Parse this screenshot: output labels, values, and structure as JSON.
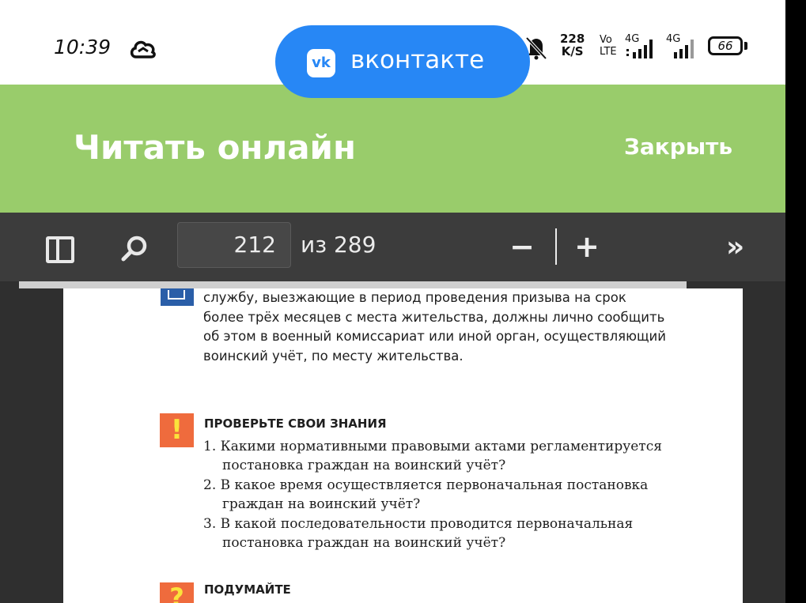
{
  "status_bar": {
    "time": "10:39",
    "net_speed_value": "228",
    "net_speed_unit": "K/S",
    "volte_line1": "Vo",
    "volte_line2": "LTE",
    "signal1_label": "4G",
    "signal2_label": "4G",
    "battery": "66"
  },
  "vk_pill": {
    "logo_letter": "vk",
    "label": "вконтакте"
  },
  "header": {
    "title": "Читать онлайн",
    "close": "Закрыть",
    "color": "#99cc6b"
  },
  "pdf_toolbar": {
    "page_current": "212",
    "page_total_label": "из 289",
    "zoom_out": "−",
    "zoom_in": "+",
    "more": "»",
    "progress_fraction": 0.85
  },
  "document": {
    "top_paragraph": "службу, выезжающие в период проведения призыва на срок более трёх месяцев с места жительства, должны лично сообщить об этом в военный комиссариат или иной орган, осуществляющий воинский учёт, по месту жительства.",
    "check_section": {
      "icon": "!",
      "title": "ПРОВЕРЬТЕ СВОИ ЗНАНИЯ",
      "questions": [
        "1. Какими нормативными правовыми актами регламентируется постановка граждан на воинский учёт?",
        "2. В какое время осуществляется первоначальная постановка граждан на воинский учёт?",
        "3. В какой последовательности проводится первоначальная постановка граждан на воинский учёт?"
      ]
    },
    "think_section": {
      "icon": "?",
      "title": "ПОДУМАЙТЕ"
    }
  }
}
